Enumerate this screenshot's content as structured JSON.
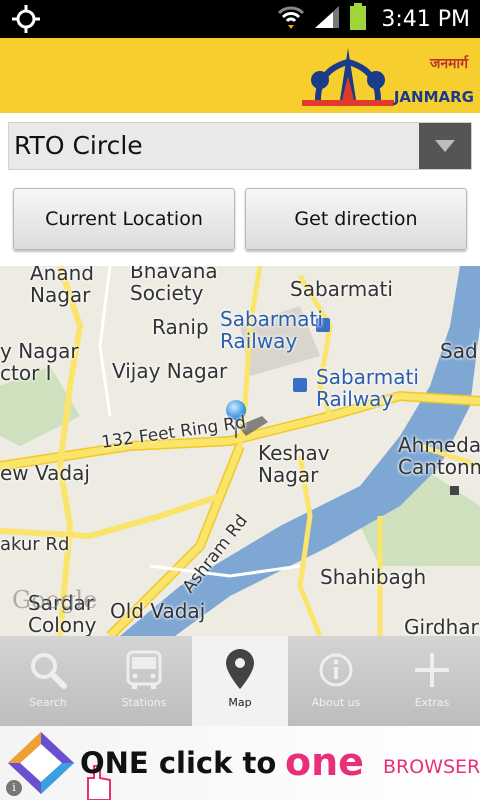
{
  "status_bar": {
    "time": "3:41 PM"
  },
  "header": {
    "logo_text": "JANMARG",
    "logo_hindi": "जनमार्ग"
  },
  "destination": {
    "selected": "RTO Circle"
  },
  "buttons": {
    "current_location": "Current Location",
    "get_direction": "Get direction"
  },
  "map": {
    "labels": {
      "anand_nagar": "Anand\nNagar",
      "bhavana_society": "Bhavana\nSociety",
      "sabarmati": "Sabarmati",
      "ranip": "Ranip",
      "sabarmati_railway_1": "Sabarmati\nRailway",
      "sabarmati_railway_2": "Sabarmati\nRailway",
      "y_nagar": "y Nagar",
      "sector_i": "ctor I",
      "vijay_nagar": "Vijay Nagar",
      "sad": "Sad",
      "ring_rd": "132 Feet Ring Rd",
      "keshav_nagar": "Keshav\nNagar",
      "ahmedabad_cantonment": "Ahmedab\nCantonm",
      "new_vadaj": "ew Vadaj",
      "ashram_rd": "Ashram Rd",
      "akur_rd": "akur Rd",
      "shahibagh": "Shahibagh",
      "sardar_colony": "Sardar\nColony",
      "old_vadaj": "Old Vadaj",
      "girdhar": "Girdhar"
    },
    "attribution": "Google"
  },
  "tabs": [
    {
      "label": "Search",
      "icon": "search-icon",
      "active": false
    },
    {
      "label": "Stations",
      "icon": "bus-icon",
      "active": false
    },
    {
      "label": "Map",
      "icon": "map-pin-icon",
      "active": true
    },
    {
      "label": "About us",
      "icon": "info-icon",
      "active": false
    },
    {
      "label": "Extras",
      "icon": "plus-icon",
      "active": false
    }
  ],
  "ad": {
    "text1": "ONE click to",
    "text2": "one",
    "text3": "BROWSER",
    "info": "i"
  },
  "colors": {
    "header": "#f6cf2e",
    "road": "#fbe46a",
    "river": "#7fa7d4",
    "brand_blue": "#1a3a8a",
    "ad_pink": "#e8307a"
  }
}
